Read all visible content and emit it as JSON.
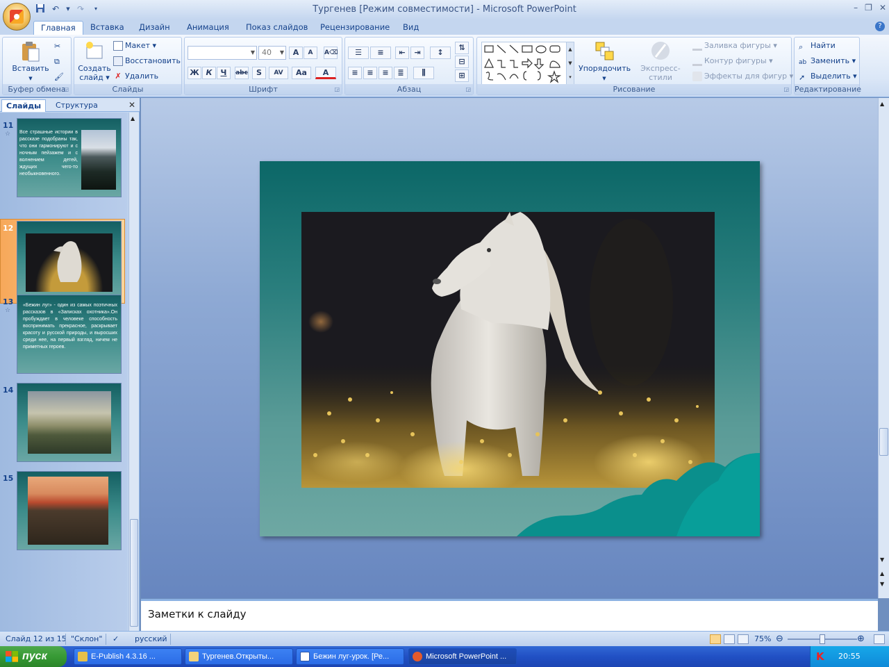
{
  "window": {
    "title": "Тургенев [Режим совместимости] - Microsoft PowerPoint"
  },
  "quick_access": [
    "save-icon",
    "undo-icon",
    "redo-icon",
    "customize-icon"
  ],
  "tabs": [
    {
      "label": "Главная",
      "active": true
    },
    {
      "label": "Вставка"
    },
    {
      "label": "Дизайн"
    },
    {
      "label": "Анимация"
    },
    {
      "label": "Показ слайдов"
    },
    {
      "label": "Рецензирование"
    },
    {
      "label": "Вид"
    }
  ],
  "ribbon": {
    "clipboard": {
      "label": "Буфер обмена",
      "paste": "Вставить"
    },
    "slides": {
      "label": "Слайды",
      "new_slide_1": "Создать",
      "new_slide_2": "слайд",
      "layout": "Макет",
      "reset": "Восстановить",
      "delete": "Удалить"
    },
    "font": {
      "label": "Шрифт",
      "font_name": "",
      "font_size": "40"
    },
    "paragraph": {
      "label": "Абзац"
    },
    "drawing": {
      "label": "Рисование",
      "arrange": "Упорядочить",
      "quick_styles": "Экспресс-стили",
      "shape_fill": "Заливка фигуры",
      "shape_outline": "Контур фигуры",
      "shape_effects": "Эффекты для фигур"
    },
    "editing": {
      "label": "Редактирование",
      "find": "Найти",
      "replace": "Заменить",
      "select": "Выделить"
    }
  },
  "panel": {
    "tab_slides": "Слайды",
    "tab_outline": "Структура",
    "thumbnails": [
      {
        "num": "11",
        "text": "Все страшные истории в рассказе подобраны так, что они гармонируют и с ночным пейзажем и с волнением детей, ждущих чего-то необыкновенного."
      },
      {
        "num": "12",
        "selected": true
      },
      {
        "num": "13",
        "text": "«Бежин луг» - один из самых поэтичных рассказов в «Записках охотника».Он пробуждает в человеке способность воспринимать прекрасное, раскрывает красоту и русской природы, и выросших среди нее, на первый взгляд, ничем не приметных героев."
      },
      {
        "num": "14"
      },
      {
        "num": "15"
      }
    ]
  },
  "notes": {
    "placeholder": "Заметки к слайду"
  },
  "status": {
    "slide_pos": "Слайд 12 из 15",
    "theme": "\"Склон\"",
    "language": "русский",
    "zoom": "75%",
    "zoom_level": 0.5
  },
  "taskbar": {
    "start": "пуск",
    "tasks": [
      {
        "label": "E-Publish 4.3.16 ...",
        "icon": "epublish-icon"
      },
      {
        "label": "Тургенев.Открыты...",
        "icon": "folder-icon"
      },
      {
        "label": "Бежин луг-урок. [Ре...",
        "icon": "word-icon"
      },
      {
        "label": "Microsoft PowerPoint ...",
        "icon": "powerpoint-icon",
        "active": true
      }
    ],
    "tray": {
      "lang": "RU",
      "time": "20:55"
    }
  },
  "colors": {
    "ribbon_bg": "#dbe7f7",
    "slide_bg": "#0b6767",
    "taskbar": "#2150c4",
    "start": "#379a35",
    "selection": "#f7a85a"
  }
}
